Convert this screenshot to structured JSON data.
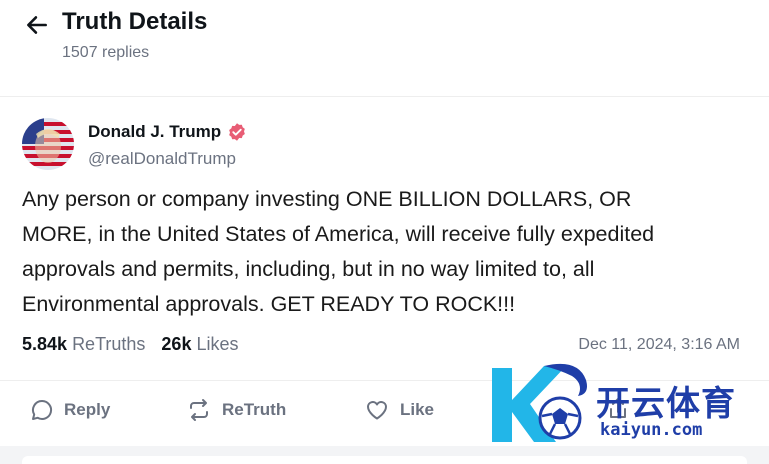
{
  "header": {
    "title": "Truth Details",
    "subtitle": "1507 replies"
  },
  "post": {
    "author_name": "Donald J. Trump",
    "author_handle": "@realDonaldTrump",
    "lines": [
      "Any person or company investing ONE BILLION DOLLARS, OR",
      "MORE, in the United States of America, will receive fully expedited",
      "approvals and permits, including, but in no way limited to, all",
      "Environmental approvals. GET READY TO ROCK!!!"
    ],
    "retruths_count": "5.84k",
    "retruths_label": "ReTruths",
    "likes_count": "26k",
    "likes_label": "Likes",
    "timestamp": "Dec 11, 2024, 3:16 AM"
  },
  "actions": {
    "reply_label": "Reply",
    "retruth_label": "ReTruth",
    "like_label": "Like"
  },
  "watermark": {
    "cn_text": "开云体育",
    "url_text": "kaiyun.com"
  },
  "colors": {
    "verified_badge": "#e85d75",
    "watermark_blue": "#1f3ea8",
    "watermark_cyan": "#22b6e8"
  },
  "icons": {
    "back": "arrow-left-icon",
    "verified": "verified-badge-icon",
    "reply": "speech-bubble-icon",
    "retruth": "repeat-arrows-icon",
    "like": "heart-icon",
    "share": "share-upload-icon"
  }
}
